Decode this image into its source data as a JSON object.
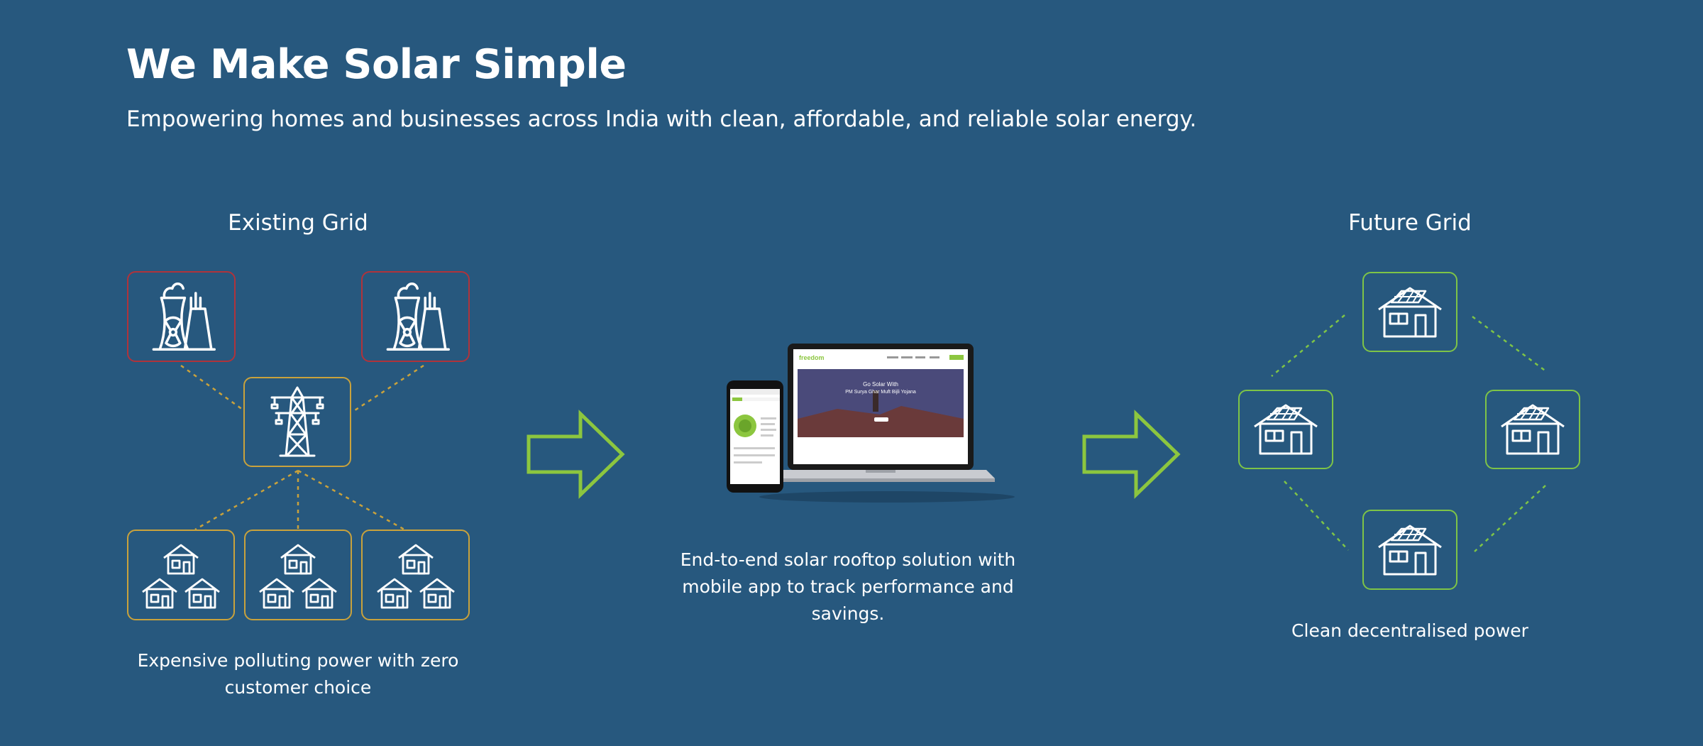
{
  "header": {
    "title": "We Make Solar Simple",
    "subtitle": "Empowering homes and businesses across India with clean, affordable, and reliable solar energy."
  },
  "existing_grid": {
    "title": "Existing Grid",
    "caption_line1": "Expensive polluting power with zero",
    "caption_line2": "customer choice"
  },
  "solution": {
    "caption_line1": "End-to-end solar rooftop solution with",
    "caption_line2": "mobile app to track performance and",
    "caption_line3": "savings.",
    "laptop_hero_line1": "Go Solar With",
    "laptop_hero_line2": "PM Surya Ghar Muft Bijli Yojana"
  },
  "future_grid": {
    "title": "Future Grid",
    "caption": "Clean decentralised power"
  },
  "colors": {
    "background": "#27587e",
    "plant_border": "#b0333b",
    "grid_border": "#c9a23c",
    "future_border": "#7ec447",
    "arrow": "#8cc63f"
  },
  "icons": {
    "power_plant": "nuclear-plant-icon",
    "tower": "transmission-tower-icon",
    "houses": "houses-cluster-icon",
    "solar_house": "solar-house-icon",
    "arrow": "right-arrow-icon"
  }
}
